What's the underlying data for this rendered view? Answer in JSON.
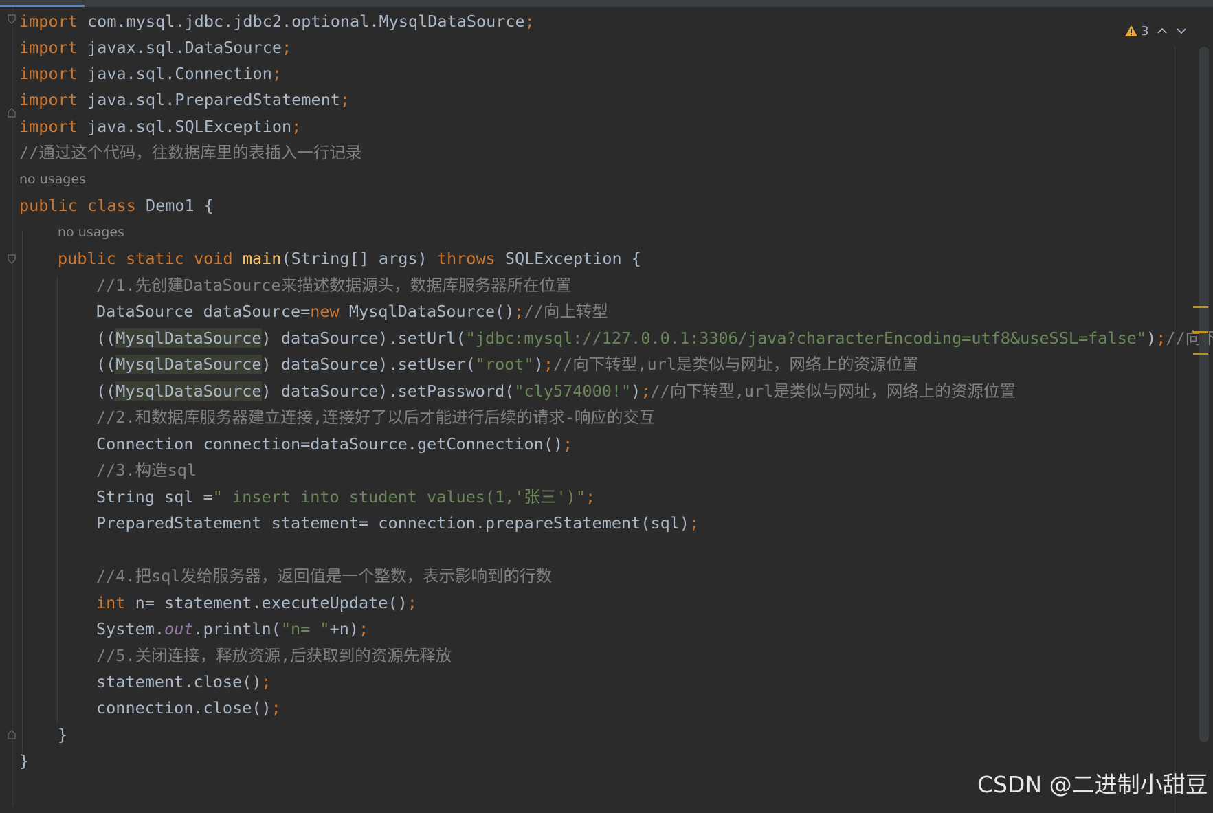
{
  "editor": {
    "imports": {
      "l1_kw": "import",
      "l1_rest": " com.mysql.jdbc.jdbc2.optional.MysqlDataSource",
      "l2_kw": "import",
      "l2_rest": " javax.sql.DataSource",
      "l3_kw": "import",
      "l3_rest": " java.sql.Connection",
      "l4_kw": "import",
      "l4_rest": " java.sql.PreparedStatement",
      "l5_kw": "import",
      "l5_rest": " java.sql.SQLException",
      "semicolon": ";"
    },
    "comment_top": "//通过这个代码，往数据库里的表插入一行记录",
    "class_usages": "no usages",
    "class_decl": {
      "kw_public": "public",
      "kw_class": "class",
      "name": " Demo1 {"
    },
    "method_usages": "no usages",
    "method_decl": {
      "kw_public": "public",
      "kw_static": "static",
      "kw_void": "void",
      "name": "main",
      "params": "(String[] args) ",
      "kw_throws": "throws",
      "rest": " SQLException {"
    },
    "body": {
      "c1": "//1.先创建DataSource来描述数据源头，数据库服务器所在位置",
      "ds_a": "DataSource dataSource=",
      "ds_new": "new",
      "ds_b": " MysqlDataSource()",
      "ds_semi": ";",
      "ds_cmt": "//向上转型",
      "url_a": "((",
      "url_cls": "MysqlDataSource",
      "url_b": ") dataSource).setUrl(",
      "url_str": "\"jdbc:mysql://127.0.0.1:3306/java?characterEncoding=utf8&useSSL=false\"",
      "url_c": ")",
      "url_semi": ";",
      "url_cmt": "//向下转型",
      "user_a": "((",
      "user_cls": "MysqlDataSource",
      "user_b": ") dataSource).setUser(",
      "user_str": "\"root\"",
      "user_c": ")",
      "user_semi": ";",
      "user_cmt": "//向下转型,url是类似与网址，网络上的资源位置",
      "pw_a": "((",
      "pw_cls": "MysqlDataSource",
      "pw_b": ") dataSource).setPassword(",
      "pw_str": "\"cly574000!\"",
      "pw_c": ")",
      "pw_semi": ";",
      "pw_cmt": "//向下转型,url是类似与网址，网络上的资源位置",
      "c2": "//2.和数据库服务器建立连接,连接好了以后才能进行后续的请求-响应的交互",
      "conn": "Connection connection=dataSource.getConnection()",
      "conn_semi": ";",
      "c3": "//3.构造sql",
      "sql_a": "String sql =",
      "sql_str": "\" insert into student values(1,'张三')\"",
      "sql_semi": ";",
      "ps": "PreparedStatement statement= connection.prepareStatement(sql)",
      "ps_semi": ";",
      "c4": "//4.把sql发给服务器，返回值是一个整数，表示影响到的行数",
      "n_kw": "int",
      "n_rest": " n= statement.executeUpdate()",
      "n_semi": ";",
      "print_a": "System.",
      "print_out": "out",
      "print_b": ".println(",
      "print_str": "\"n= \"",
      "print_c": "+n)",
      "print_semi": ";",
      "c5": "//5.关闭连接，释放资源,后获取到的资源先释放",
      "close1": "statement.close()",
      "close1_semi": ";",
      "close2": "connection.close()",
      "close2_semi": ";"
    },
    "method_close": "}",
    "class_close": "}"
  },
  "inspections": {
    "warning_count": "3",
    "icons": [
      "warning-icon",
      "chevron-up-icon",
      "chevron-down-icon"
    ]
  },
  "watermark": "CSDN @二进制小甜豆",
  "colors": {
    "background": "#2b2b2b",
    "keyword": "#cc7832",
    "string": "#6a8759",
    "comment": "#808080",
    "method": "#ffc66d",
    "static_field": "#9876aa",
    "default_text": "#a9b7c6",
    "warning": "#e6a83b"
  }
}
